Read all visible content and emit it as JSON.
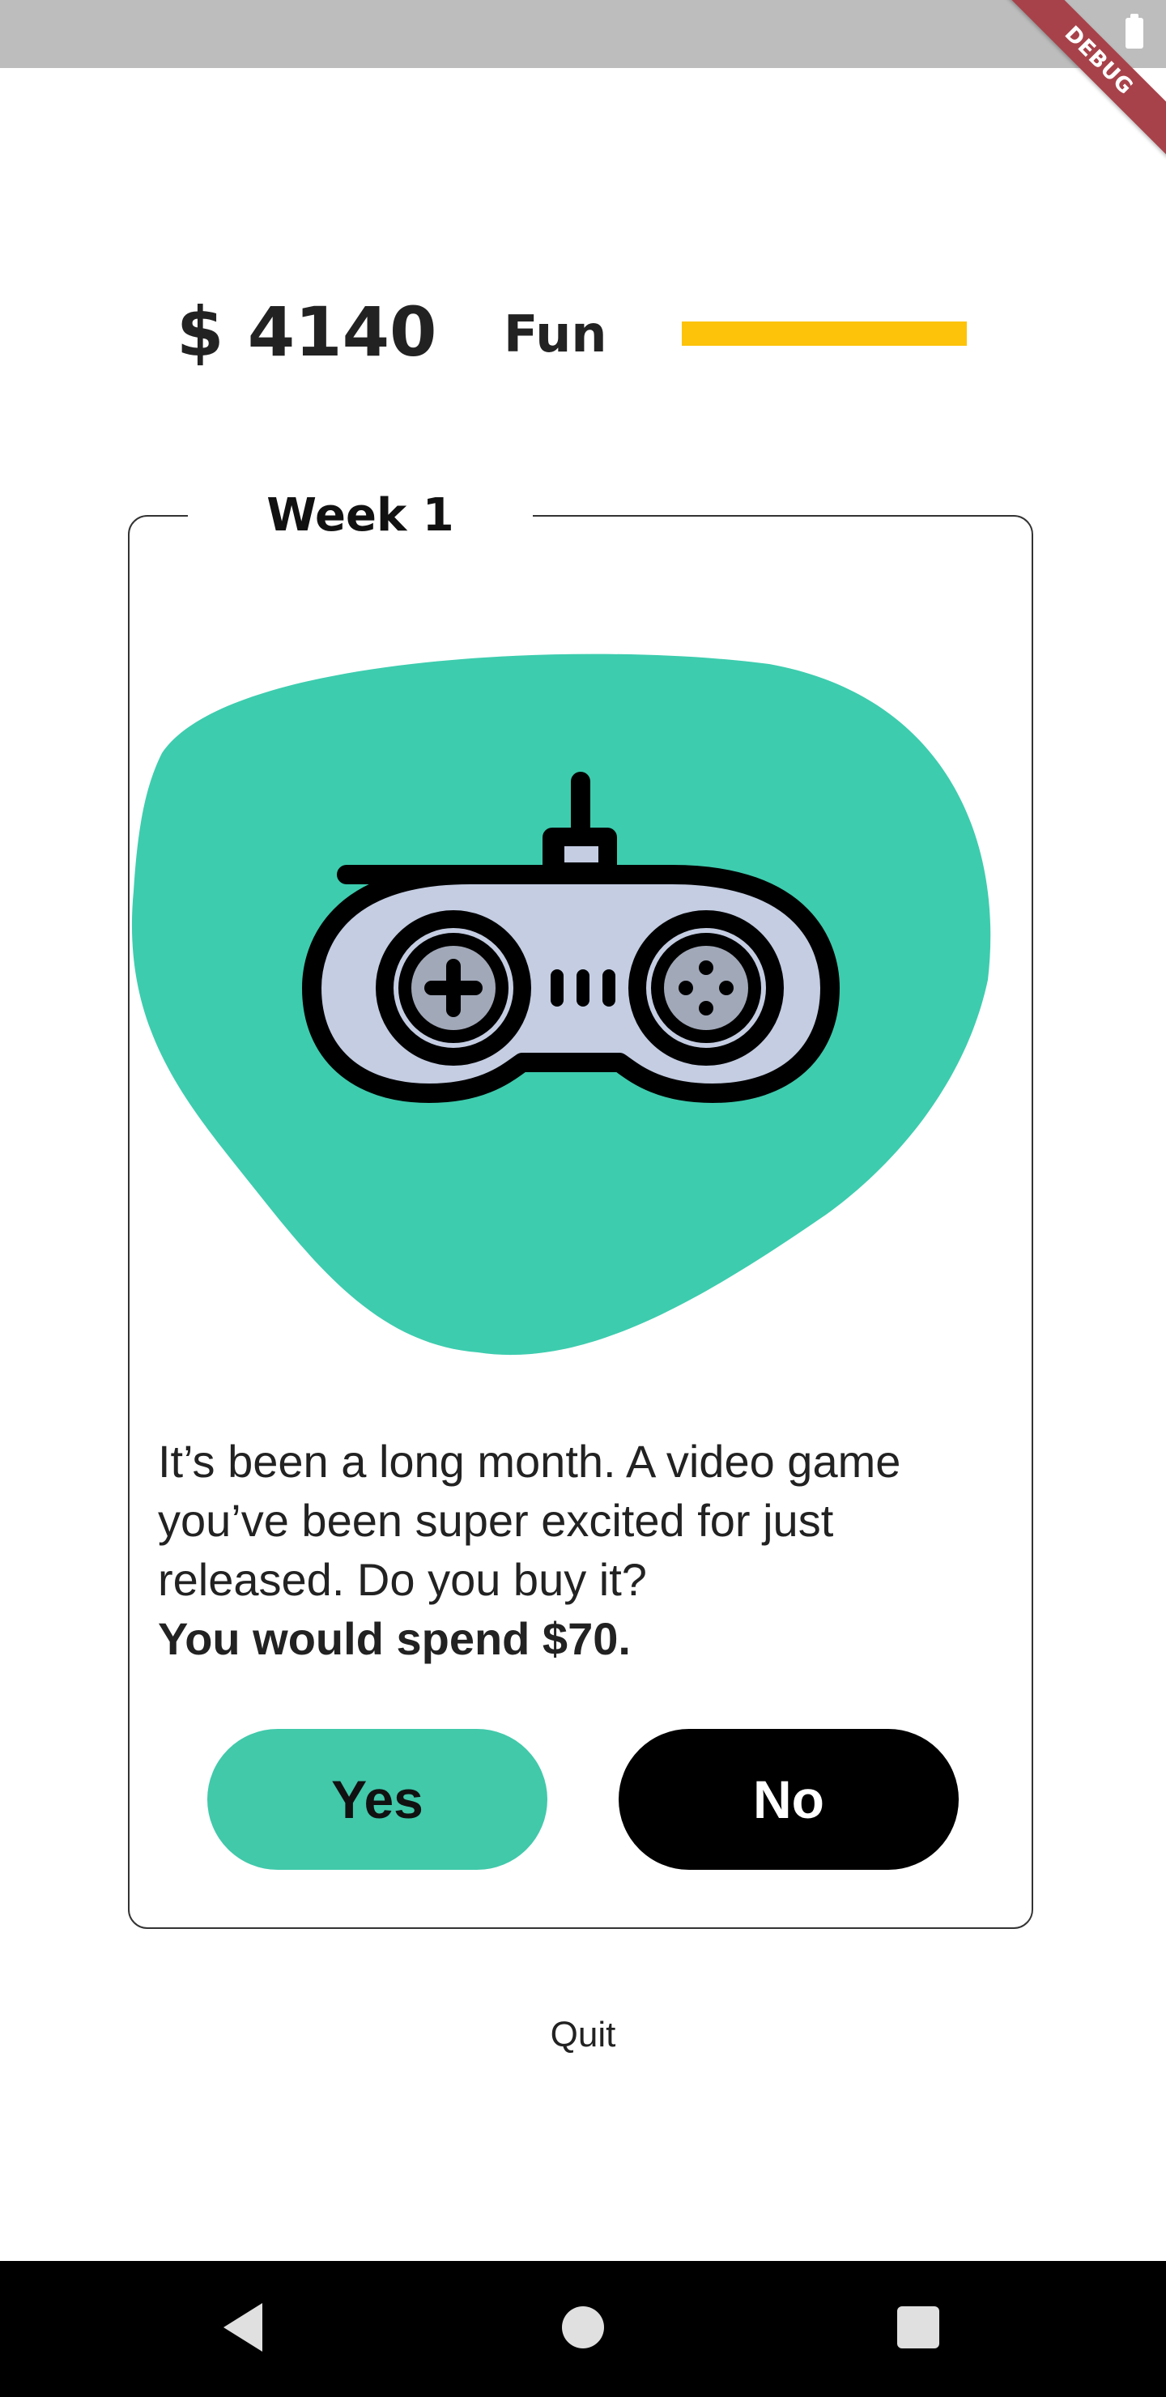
{
  "status_bar": {
    "debug_label": "DEBUG"
  },
  "header": {
    "money": "$ 4140",
    "fun_label": "Fun",
    "fun_level_fraction": 1.0,
    "fun_color": "#fcc30a"
  },
  "card": {
    "week_label": "Week 1",
    "illustration": {
      "icon": "gamepad-icon",
      "blob_color": "#3dccae"
    },
    "prompt": "It’s been a long month. A video game you’ve been super excited for just released. Do you buy it?",
    "cost": "You would spend $70.",
    "yes_label": "Yes",
    "no_label": "No",
    "yes_color": "#41c9aa",
    "no_color": "#000000"
  },
  "quit_label": "Quit",
  "nav": {
    "back_icon": "back-triangle-icon",
    "home_icon": "home-circle-icon",
    "recents_icon": "recents-square-icon"
  }
}
